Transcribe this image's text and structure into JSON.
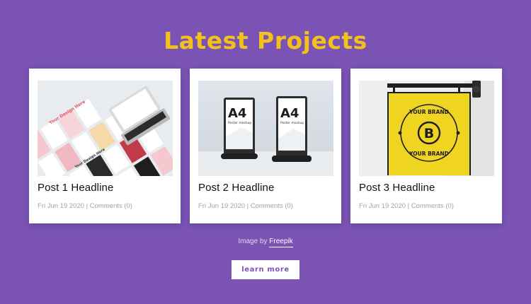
{
  "section": {
    "title": "Latest Projects"
  },
  "posts": [
    {
      "headline": "Post 1 Headline",
      "date": "Fri Jun 19 2020",
      "separator": "|",
      "comments": "Comments (0)"
    },
    {
      "headline": "Post 2 Headline",
      "date": "Fri Jun 19 2020",
      "separator": "|",
      "comments": "Comments (0)"
    },
    {
      "headline": "Post 3 Headline",
      "date": "Fri Jun 19 2020",
      "separator": "|",
      "comments": "Comments (0)"
    }
  ],
  "images": {
    "post1": {
      "screen_text": "Your Design Here"
    },
    "post2": {
      "big_text": "A4",
      "sub_text": "Poster mockup"
    },
    "post3": {
      "brand_top": "YOUR BRAND",
      "brand_letter": "B",
      "brand_bottom": "YOUR BRAND"
    }
  },
  "credit": {
    "prefix": "Image by",
    "link": "Freepik"
  },
  "cta": {
    "label": "learn more"
  },
  "colors": {
    "background": "#7a53b5",
    "title": "#f2c21b",
    "sign": "#f0d422"
  }
}
